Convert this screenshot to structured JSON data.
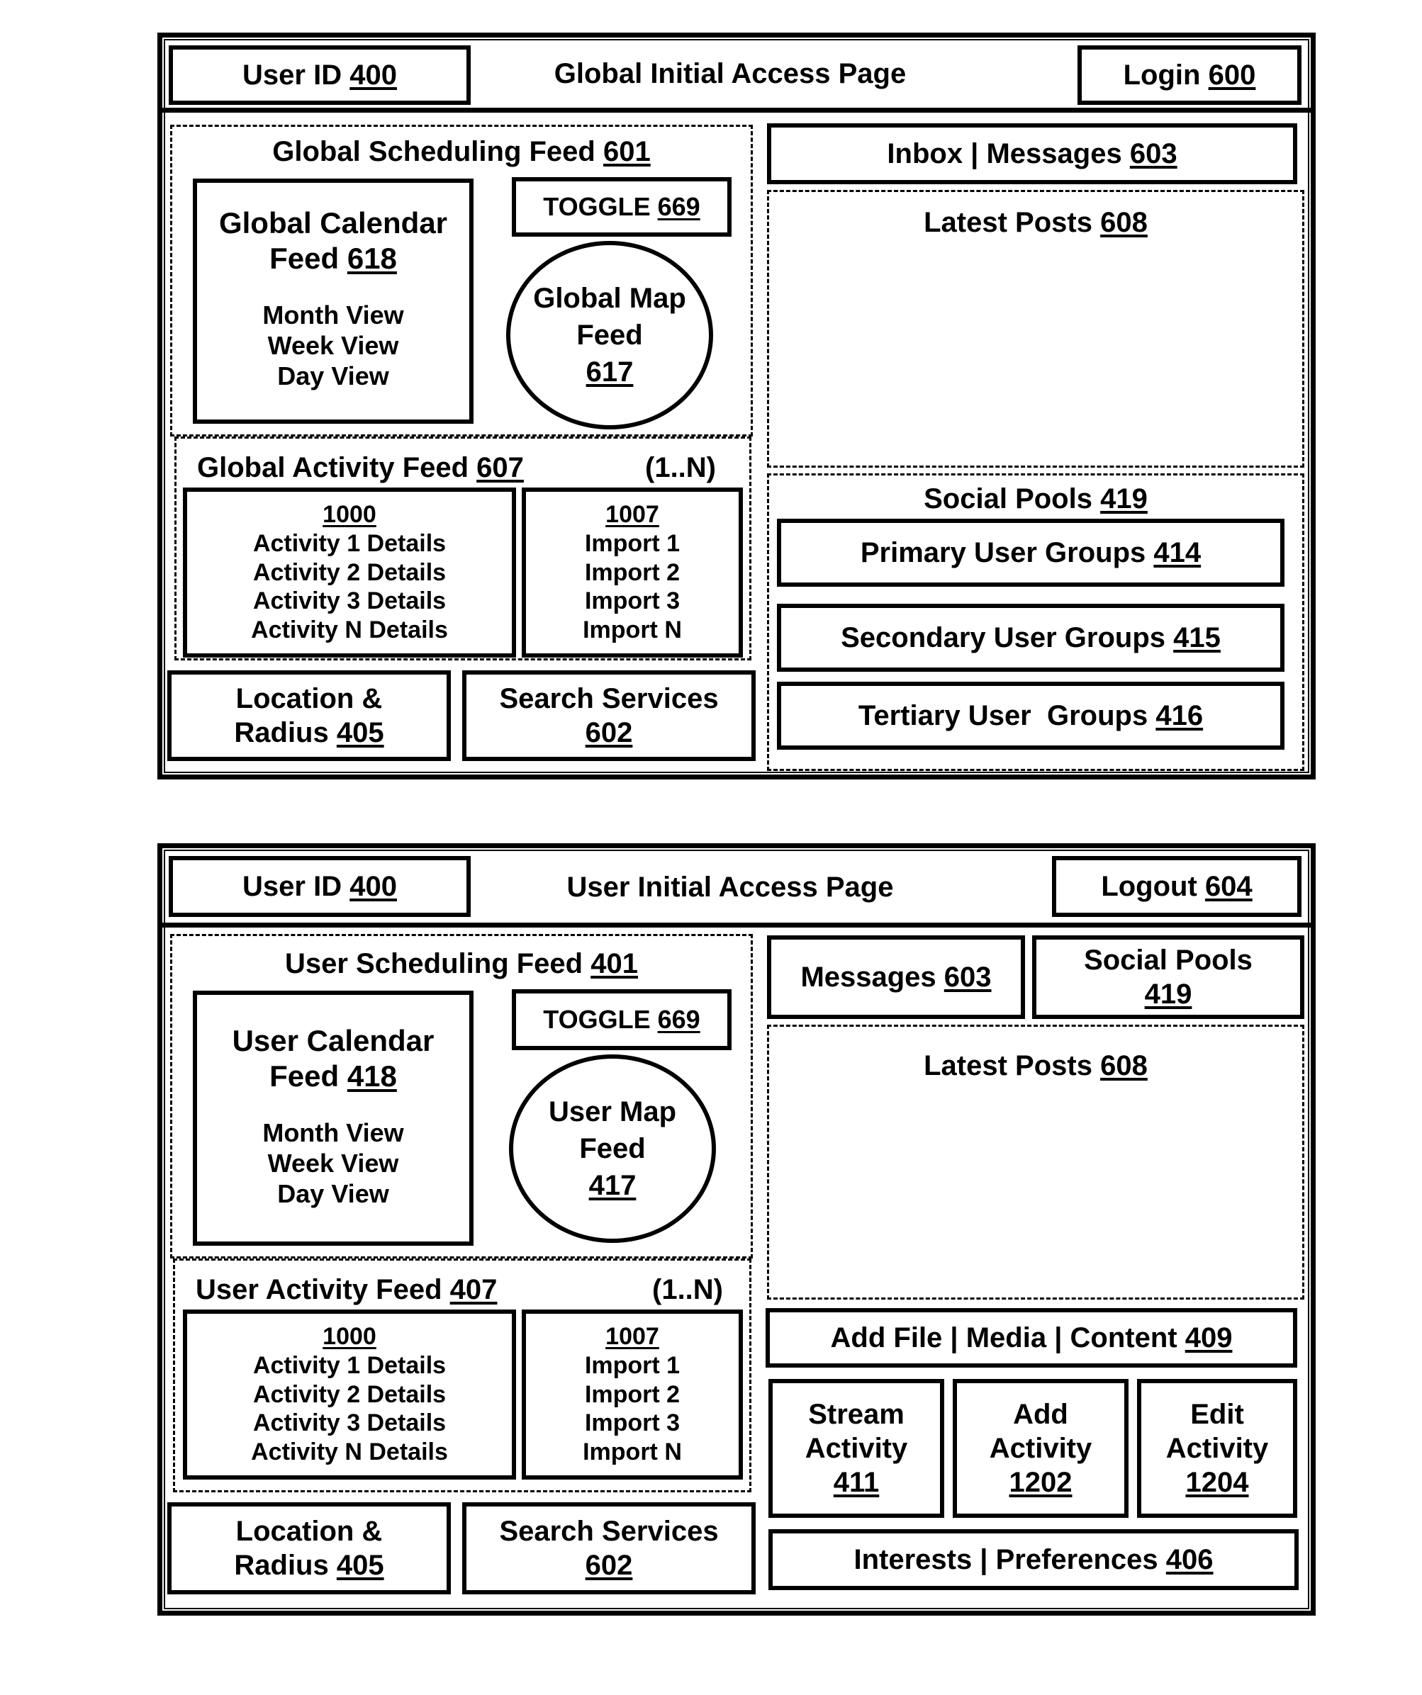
{
  "global_page": {
    "header": {
      "user_id": {
        "label": "User ID",
        "ref": "400"
      },
      "title": "Global Initial Access Page",
      "login": {
        "label": "Login",
        "ref": "600"
      }
    },
    "scheduling_feed": {
      "label": "Global Scheduling Feed",
      "ref": "601"
    },
    "calendar_feed": {
      "line1": "Global Calendar",
      "line2": "Feed",
      "ref": "618",
      "views": [
        "Month View",
        "Week View",
        "Day View"
      ]
    },
    "toggle": {
      "label": "TOGGLE",
      "ref": "669"
    },
    "map_feed": {
      "line1": "Global Map",
      "line2": "Feed",
      "ref": "617"
    },
    "activity_feed": {
      "label": "Global Activity Feed",
      "ref": "607",
      "range": "(1..N)"
    },
    "activities": {
      "ref": "1000",
      "items": [
        "Activity 1 Details",
        "Activity 2 Details",
        "Activity 3 Details",
        "Activity N Details"
      ]
    },
    "imports": {
      "ref": "1007",
      "items": [
        "Import 1",
        "Import 2",
        "Import 3",
        "Import N"
      ]
    },
    "location": {
      "line1": "Location &",
      "line2": "Radius",
      "ref": "405"
    },
    "search": {
      "line1": "Search Services",
      "ref": "602"
    },
    "inbox": {
      "label": "Inbox | Messages",
      "ref": "603"
    },
    "latest_posts": {
      "label": "Latest Posts",
      "ref": "608"
    },
    "social_pools": {
      "label": "Social Pools",
      "ref": "419"
    },
    "primary_groups": {
      "label": "Primary User Groups",
      "ref": "414"
    },
    "secondary_groups": {
      "label": "Secondary User Groups",
      "ref": "415"
    },
    "tertiary_groups": {
      "label": "Tertiary User  Groups",
      "ref": "416"
    }
  },
  "user_page": {
    "header": {
      "user_id": {
        "label": "User ID",
        "ref": "400"
      },
      "title": "User Initial Access Page",
      "logout": {
        "label": "Logout",
        "ref": "604"
      }
    },
    "scheduling_feed": {
      "label": "User Scheduling Feed",
      "ref": "401"
    },
    "calendar_feed": {
      "line1": "User Calendar",
      "line2": "Feed",
      "ref": "418",
      "views": [
        "Month View",
        "Week View",
        "Day View"
      ]
    },
    "toggle": {
      "label": "TOGGLE",
      "ref": "669"
    },
    "map_feed": {
      "line1": "User Map",
      "line2": "Feed",
      "ref": "417"
    },
    "activity_feed": {
      "label": "User Activity Feed",
      "ref": "407",
      "range": "(1..N)"
    },
    "activities": {
      "ref": "1000",
      "items": [
        "Activity 1 Details",
        "Activity 2 Details",
        "Activity 3 Details",
        "Activity N Details"
      ]
    },
    "imports": {
      "ref": "1007",
      "items": [
        "Import 1",
        "Import 2",
        "Import 3",
        "Import N"
      ]
    },
    "location": {
      "line1": "Location &",
      "line2": "Radius",
      "ref": "405"
    },
    "search": {
      "line1": "Search Services",
      "ref": "602"
    },
    "messages": {
      "label": "Messages",
      "ref": "603"
    },
    "social_pools": {
      "line1": "Social Pools",
      "ref": "419"
    },
    "latest_posts": {
      "label": "Latest Posts",
      "ref": "608"
    },
    "add_file": {
      "label": "Add File | Media | Content",
      "ref": "409"
    },
    "stream_activity": {
      "line1": "Stream",
      "line2": "Activity",
      "ref": "411"
    },
    "add_activity": {
      "line1": "Add",
      "line2": "Activity",
      "ref": "1202"
    },
    "edit_activity": {
      "line1": "Edit",
      "line2": "Activity",
      "ref": "1204"
    },
    "interests": {
      "label": "Interests | Preferences",
      "ref": "406"
    }
  }
}
